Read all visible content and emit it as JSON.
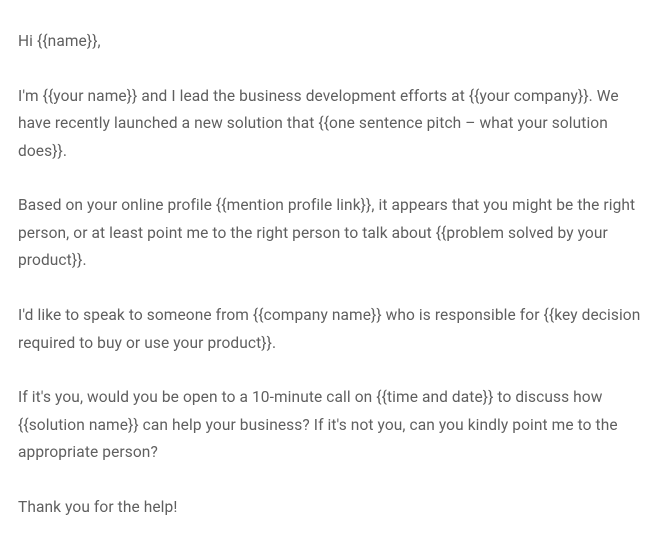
{
  "email": {
    "greeting": "Hi {{name}},",
    "intro": "I'm {{your name}} and I lead the business development efforts at {{your company}}. We have recently launched a new solution that {{one sentence pitch – what your solution does}}.",
    "profile": "Based on your online profile {{mention profile link}}, it appears that you might be the right person, or at least point me to the right person to talk about {{problem solved by your product}}.",
    "request": "I'd like to speak to someone from {{company name}} who is responsible for {{key decision required to buy or use your product}}.",
    "call_to_action": "If it's you, would you be open to a 10-minute call on {{time and date}} to discuss how {{solution name}} can help your business? If it's not you, can you kindly point me to the appropriate person?",
    "closing": "Thank you for the help!"
  }
}
